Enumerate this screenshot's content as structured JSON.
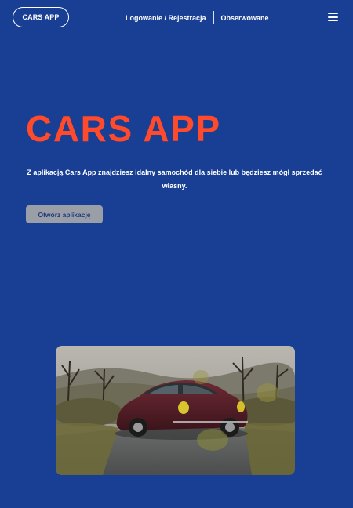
{
  "header": {
    "logo_label": "CARS APP",
    "nav": {
      "login_label": "Logowanie / Rejestracja",
      "watched_label": "Obserwowane"
    }
  },
  "hero": {
    "title": "CARS APP",
    "description": "Z aplikacją Cars App znajdziesz idalny samochód dla siebie lub będziesz mógł sprzedać własny.",
    "cta_label": "Otwórz aplikację"
  },
  "colors": {
    "background": "#183f94",
    "title": "#ff4a2b",
    "button": "#9a9ea7",
    "button_text": "#1f3a7e",
    "text": "#ffffff"
  },
  "icons": {
    "menu": "hamburger-icon"
  }
}
